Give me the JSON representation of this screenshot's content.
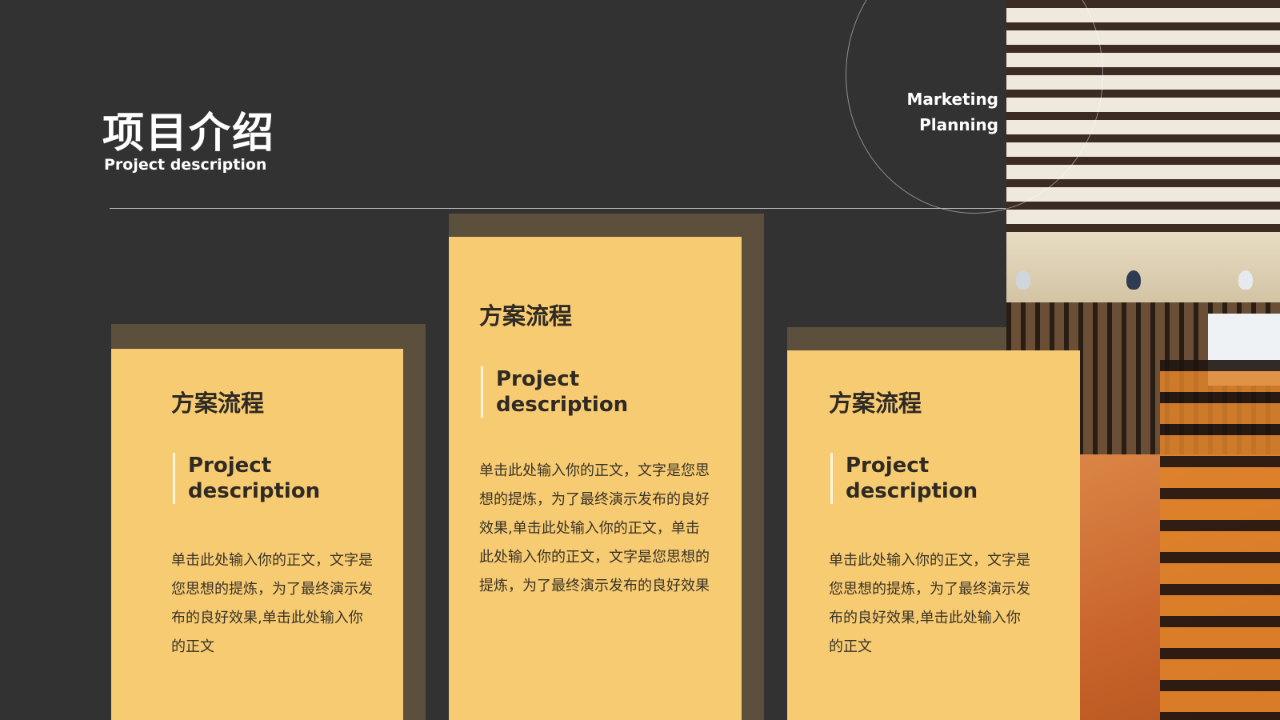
{
  "header": {
    "title": "项目介绍",
    "subtitle": "Project description",
    "side_label_line1": "Marketing",
    "side_label_line2": "Planning"
  },
  "cards": [
    {
      "heading": "方案流程",
      "subheading": "Project description",
      "body": "单击此处输入你的正文，文字是您思想的提炼，为了最终演示发布的良好效果,单击此处输入你的正文"
    },
    {
      "heading": "方案流程",
      "subheading": "Project description",
      "body": "单击此处输入你的正文，文字是您思想的提炼，为了最终演示发布的良好效果,单击此处输入你的正文，单击此处输入你的正文，文字是您思想的提炼，为了最终演示发布的良好效果"
    },
    {
      "heading": "方案流程",
      "subheading": "Project description",
      "body": "单击此处输入你的正文，文字是您思想的提炼，为了最终演示发布的良好效果,单击此处输入你的正文"
    }
  ],
  "colors": {
    "background": "#323232",
    "card": "#f6cb72",
    "card_shadow": "#5c4f3c",
    "text_dark": "#2f2a24",
    "text_light": "#ffffff"
  }
}
